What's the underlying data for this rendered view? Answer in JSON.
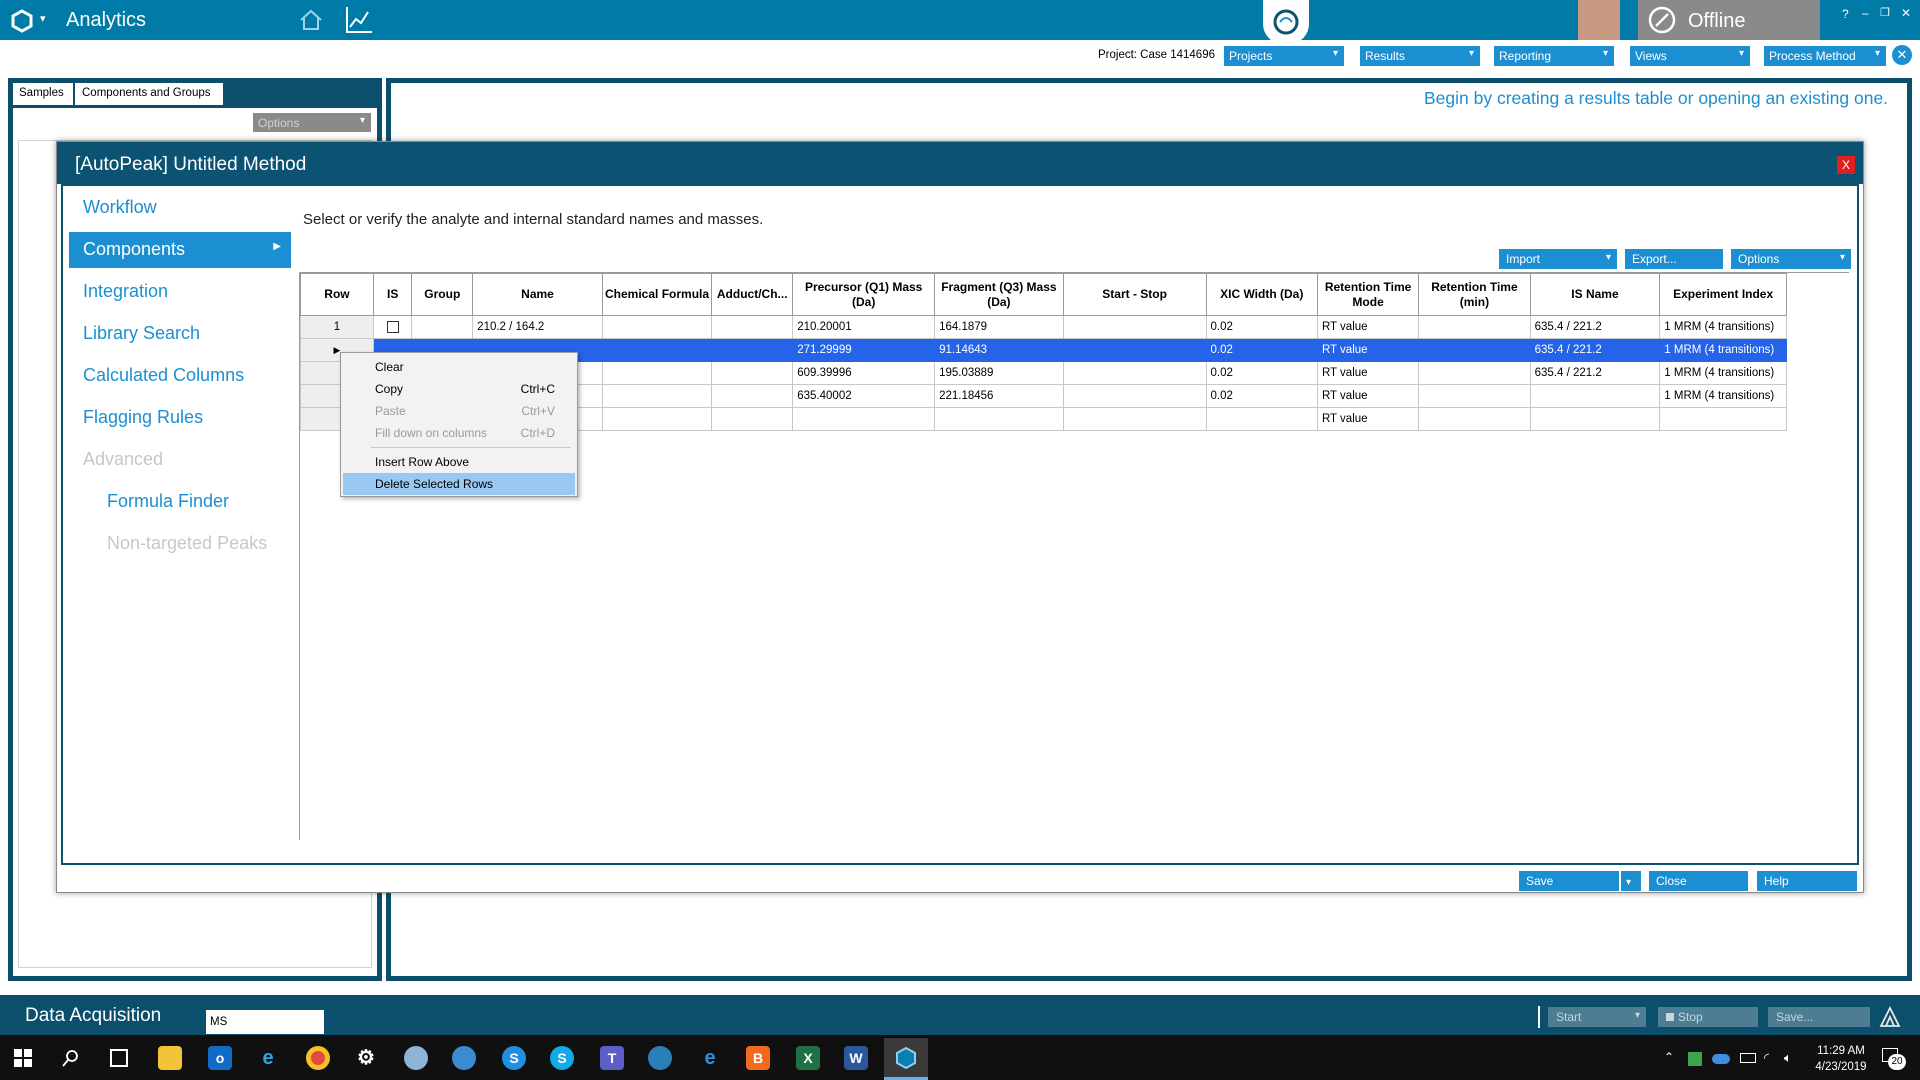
{
  "app": {
    "title": "Analytics",
    "status": "Offline"
  },
  "topbar": {
    "project_label": "Project: Case 1414696",
    "menus": [
      "Projects",
      "Results",
      "Reporting",
      "Views",
      "Process Method"
    ],
    "window_controls": [
      "?",
      "–",
      "❐",
      "✕"
    ]
  },
  "left_panel": {
    "tabs": [
      "Samples",
      "Components and Groups"
    ],
    "options_label": "Options"
  },
  "main": {
    "hint": "Begin by creating a results table or opening an existing one."
  },
  "dialog": {
    "title": "[AutoPeak] Untitled Method",
    "close": "X",
    "instruction": "Select or verify the analyte and internal standard names and masses.",
    "nav": [
      {
        "label": "Workflow",
        "state": "normal"
      },
      {
        "label": "Components",
        "state": "active"
      },
      {
        "label": "Integration",
        "state": "normal"
      },
      {
        "label": "Library Search",
        "state": "normal"
      },
      {
        "label": "Calculated Columns",
        "state": "normal"
      },
      {
        "label": "Flagging Rules",
        "state": "normal"
      },
      {
        "label": "Advanced",
        "state": "disabled"
      },
      {
        "label": "Formula Finder",
        "state": "sub"
      },
      {
        "label": "Non-targeted Peaks",
        "state": "sub-disabled"
      }
    ],
    "toolbar": {
      "import": "Import",
      "export": "Export...",
      "options": "Options"
    },
    "table": {
      "headers": [
        "Row",
        "IS",
        "Group",
        "Name",
        "Chemical Formula",
        "Adduct/Ch...",
        "Precursor (Q1) Mass (Da)",
        "Fragment (Q3) Mass (Da)",
        "Start - Stop",
        "XIC Width (Da)",
        "Retention Time Mode",
        "Retention Time (min)",
        "IS Name",
        "Experiment Index"
      ],
      "rows": [
        [
          "1",
          "",
          "",
          "210.2 / 164.2",
          "",
          "",
          "210.20001",
          "164.1879",
          "",
          "0.02",
          "RT value",
          "",
          "635.4 / 221.2",
          "1 MRM (4 transitions)"
        ],
        [
          "",
          "",
          "",
          "",
          "",
          "",
          "271.29999",
          "91.14643",
          "",
          "0.02",
          "RT value",
          "",
          "635.4 / 221.2",
          "1 MRM (4 transitions)"
        ],
        [
          "",
          "",
          "",
          "",
          "",
          "",
          "609.39996",
          "195.03889",
          "",
          "0.02",
          "RT value",
          "",
          "635.4 / 221.2",
          "1 MRM (4 transitions)"
        ],
        [
          "",
          "",
          "",
          "",
          "",
          "",
          "635.40002",
          "221.18456",
          "",
          "0.02",
          "RT value",
          "",
          "",
          "1 MRM (4 transitions)"
        ],
        [
          "",
          "",
          "",
          "",
          "",
          "",
          "",
          "",
          "",
          "",
          "RT value",
          "",
          "",
          ""
        ]
      ]
    },
    "context_menu": {
      "clear": "Clear",
      "copy": "Copy",
      "copy_sc": "Ctrl+C",
      "paste": "Paste",
      "paste_sc": "Ctrl+V",
      "fill": "Fill down on columns",
      "fill_sc": "Ctrl+D",
      "insert": "Insert Row Above",
      "delete": "Delete Selected Rows"
    },
    "footer": {
      "save": "Save",
      "close": "Close",
      "help": "Help"
    }
  },
  "bottom": {
    "title": "Data Acquisition",
    "ms_value": "MS",
    "start": "Start",
    "stop": "Stop",
    "save": "Save..."
  },
  "taskbar": {
    "time": "11:29 AM",
    "date": "4/23/2019",
    "notif": "20"
  },
  "colors": {
    "accent": "#1b8fd2",
    "brand_bar": "#007aa6",
    "dark_frame": "#0c4f6c",
    "selection": "#2563e8"
  }
}
